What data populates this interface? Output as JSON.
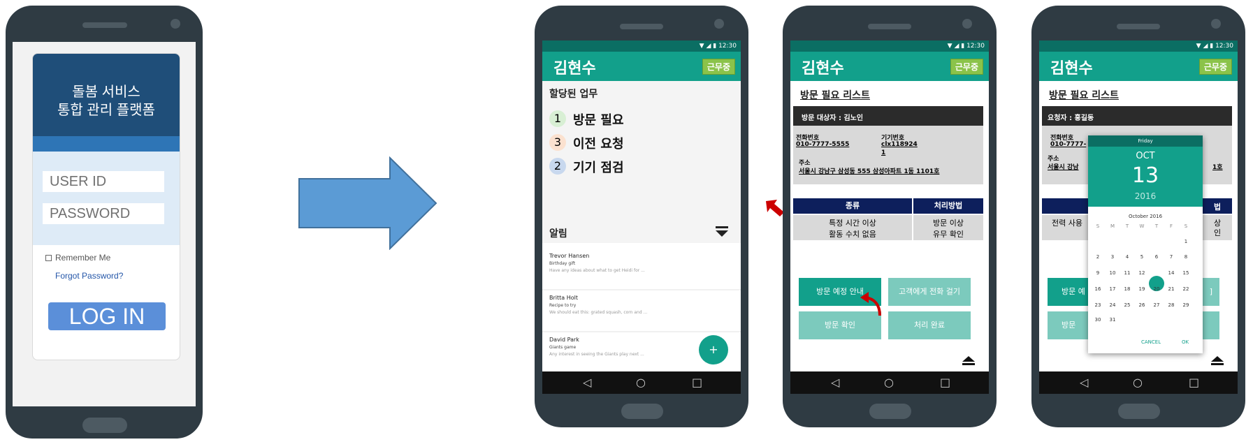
{
  "login": {
    "title_line1": "돌봄 서비스",
    "title_line2": "통합 관리 플랫폼",
    "userid_placeholder": "USER ID",
    "password_placeholder": "PASSWORD",
    "remember_label": "Remember Me",
    "forgot_label": "Forgot Password?",
    "login_button": "LOG IN"
  },
  "status": {
    "time": "12:30",
    "icons": "▼ ◢ ▮"
  },
  "worker": {
    "name": "김현수",
    "badge": "근무중"
  },
  "screen1": {
    "assigned_title": "할당된 업무",
    "tasks": [
      {
        "count": "1",
        "label": "방문 필요",
        "color": "#d8efd4"
      },
      {
        "count": "3",
        "label": "이전 요청",
        "color": "#fbe1cf"
      },
      {
        "count": "2",
        "label": "기기 점검",
        "color": "#c8d8ee"
      }
    ],
    "alerts_title": "알림",
    "notifications": [
      {
        "name": "Trevor Hansen",
        "subject": "Birthday gift",
        "preview": "Have any ideas about what to get Heidi for ..."
      },
      {
        "name": "Britta Holt",
        "subject": "Recipe to try",
        "preview": "We should eat this: grated squash, corn and ..."
      },
      {
        "name": "David Park",
        "subject": "Giants game",
        "preview": "Any interest in seeing the Giants play next ..."
      }
    ],
    "fab": "+"
  },
  "screen2": {
    "list_title": "방문 필요 리스트",
    "target_label": "방문 대상자 : 김노인",
    "phone_label": "전화번호",
    "phone_value": "010-7777-5555",
    "device_label": "기기번호",
    "device_value_line1": "clx118924",
    "device_value_line2": "1",
    "address_label": "주소",
    "address_value": "서울시 강남구 삼성동 555 삼성아파트 1동 1101호",
    "table_headers": [
      "종류",
      "처리방법"
    ],
    "row_type_line1": "특정 시간 이상",
    "row_type_line2": "활동 수치 없음",
    "row_method_line1": "방문 이상",
    "row_method_line2": "유무 확인",
    "buttons": [
      "방문 예정 안내",
      "고객에게 전화 걸기",
      "방문 확인",
      "처리 완료"
    ]
  },
  "screen3": {
    "list_title": "방문 필요 리스트",
    "requester_label": "요청자 : 홍길동",
    "phone_label": "전화번호",
    "phone_value_partial": "010-7777-",
    "address_label": "주소",
    "address_value_partial": "서울시 강남",
    "address_tail": "1호",
    "table_tail": "법",
    "row_type_partial": "전력 사용",
    "row_method_tail_1": "상",
    "row_method_tail_2": "인",
    "btn_partial_1": "방문 예",
    "btn_partial_2": "방문",
    "btn_tail": "]",
    "datepicker": {
      "weekday": "Friday",
      "month": "OCT",
      "day": "13",
      "year": "2016",
      "month_title": "October 2016",
      "day_headers": [
        "S",
        "M",
        "T",
        "W",
        "T",
        "F",
        "S"
      ],
      "cancel": "CANCEL",
      "ok": "OK",
      "selected_day": "13"
    }
  },
  "colors": {
    "teal": "#12a08b",
    "dark_teal": "#0b6e63",
    "navy": "#0d1f5c",
    "login_blue": "#1f4e79",
    "arrow_blue": "#5b9bd5",
    "red": "#cc0000"
  }
}
